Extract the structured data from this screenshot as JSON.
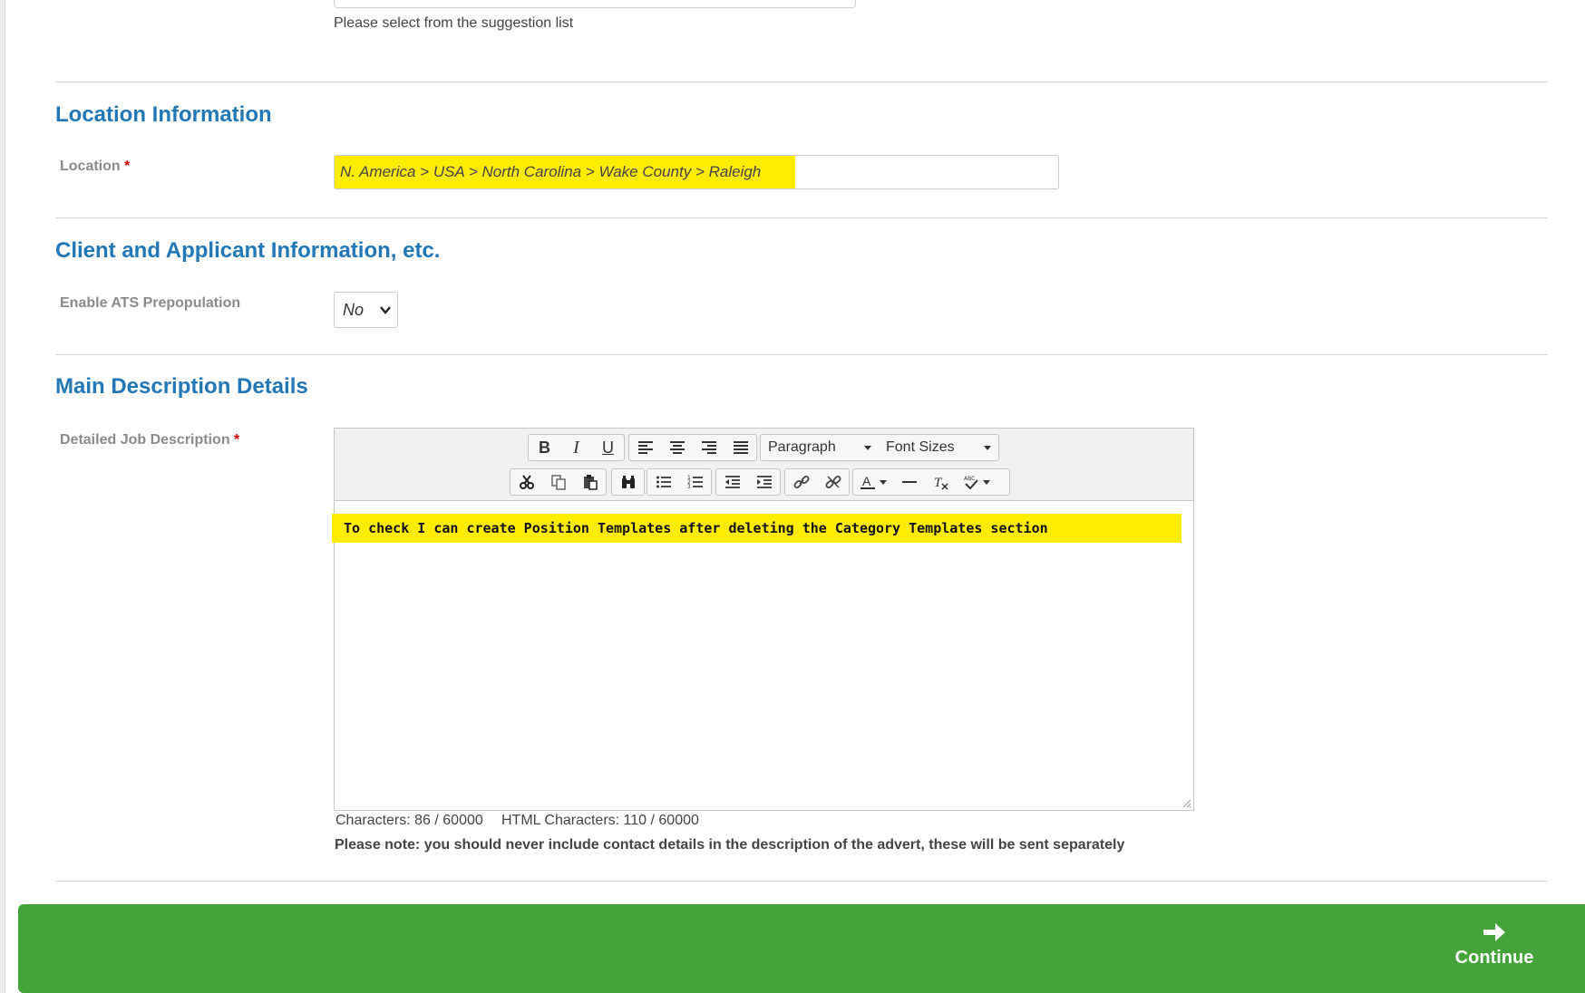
{
  "top_field": {
    "hint": "Please select from the suggestion list"
  },
  "location_section": {
    "title": "Location Information",
    "location_label": "Location",
    "required_mark": "*",
    "location_value": "N. America > USA > North Carolina > Wake County > Raleigh"
  },
  "client_section": {
    "title": "Client and Applicant Information, etc.",
    "ats_label": "Enable ATS Prepopulation",
    "ats_value": "No"
  },
  "description_section": {
    "title": "Main Description Details",
    "description_label": "Detailed Job Description",
    "required_mark": "*",
    "toolbar": {
      "bold": "B",
      "italic": "I",
      "underline": "U",
      "paragraph": "Paragraph",
      "font_sizes": "Font Sizes"
    },
    "content": "To check I can create Position Templates after deleting the Category Templates section",
    "characters": "Characters: 86 / 60000",
    "html_characters": "HTML Characters: 110 / 60000",
    "note": "Please note: you should never include contact details in the description of the advert, these will be sent separately"
  },
  "footer": {
    "continue_label": "Continue"
  },
  "colors": {
    "section_title": "#2277b7",
    "highlight": "#ffec00",
    "continue_bar": "#43a23a",
    "required": "#cc0000"
  }
}
